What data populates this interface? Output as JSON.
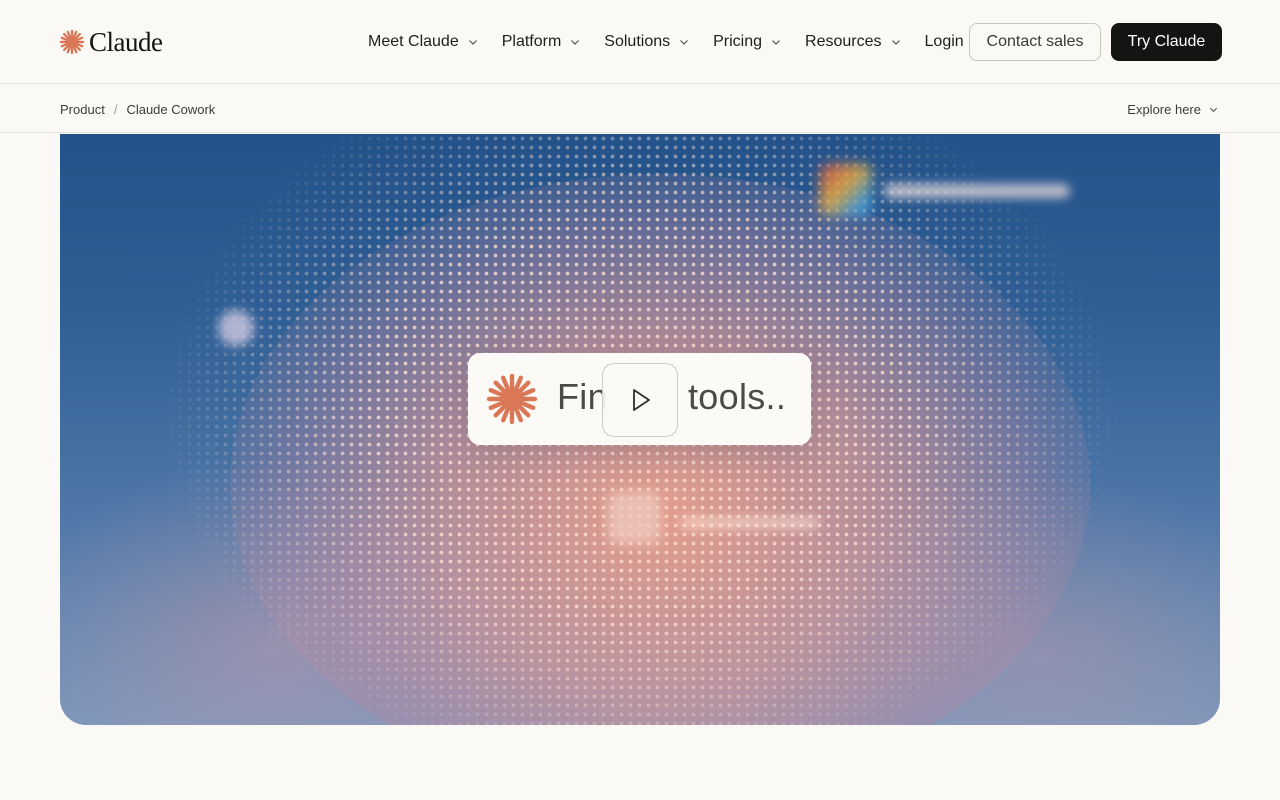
{
  "brand": {
    "name": "Claude",
    "accent_color": "#d97757",
    "logo_icon": "claude-spark-icon"
  },
  "nav": {
    "items": [
      {
        "label": "Meet Claude",
        "icon": "chevron-down-icon"
      },
      {
        "label": "Platform",
        "icon": "chevron-down-icon"
      },
      {
        "label": "Solutions",
        "icon": "chevron-down-icon"
      },
      {
        "label": "Pricing",
        "icon": "chevron-down-icon"
      },
      {
        "label": "Resources",
        "icon": "chevron-down-icon"
      }
    ],
    "login_label": "Login",
    "contact_label": "Contact sales",
    "try_label": "Try Claude"
  },
  "subnav": {
    "breadcrumb": [
      {
        "label": "Product"
      },
      {
        "label": "Claude Cowork"
      }
    ],
    "separator": "/",
    "explore_label": "Explore here"
  },
  "hero": {
    "card_text_left": "Fin",
    "card_text_right": "tools..",
    "play_icon": "play-icon",
    "colors": {
      "background_top": "#23528a",
      "glow": "#eba08c",
      "card": "#fbfaf7"
    }
  }
}
